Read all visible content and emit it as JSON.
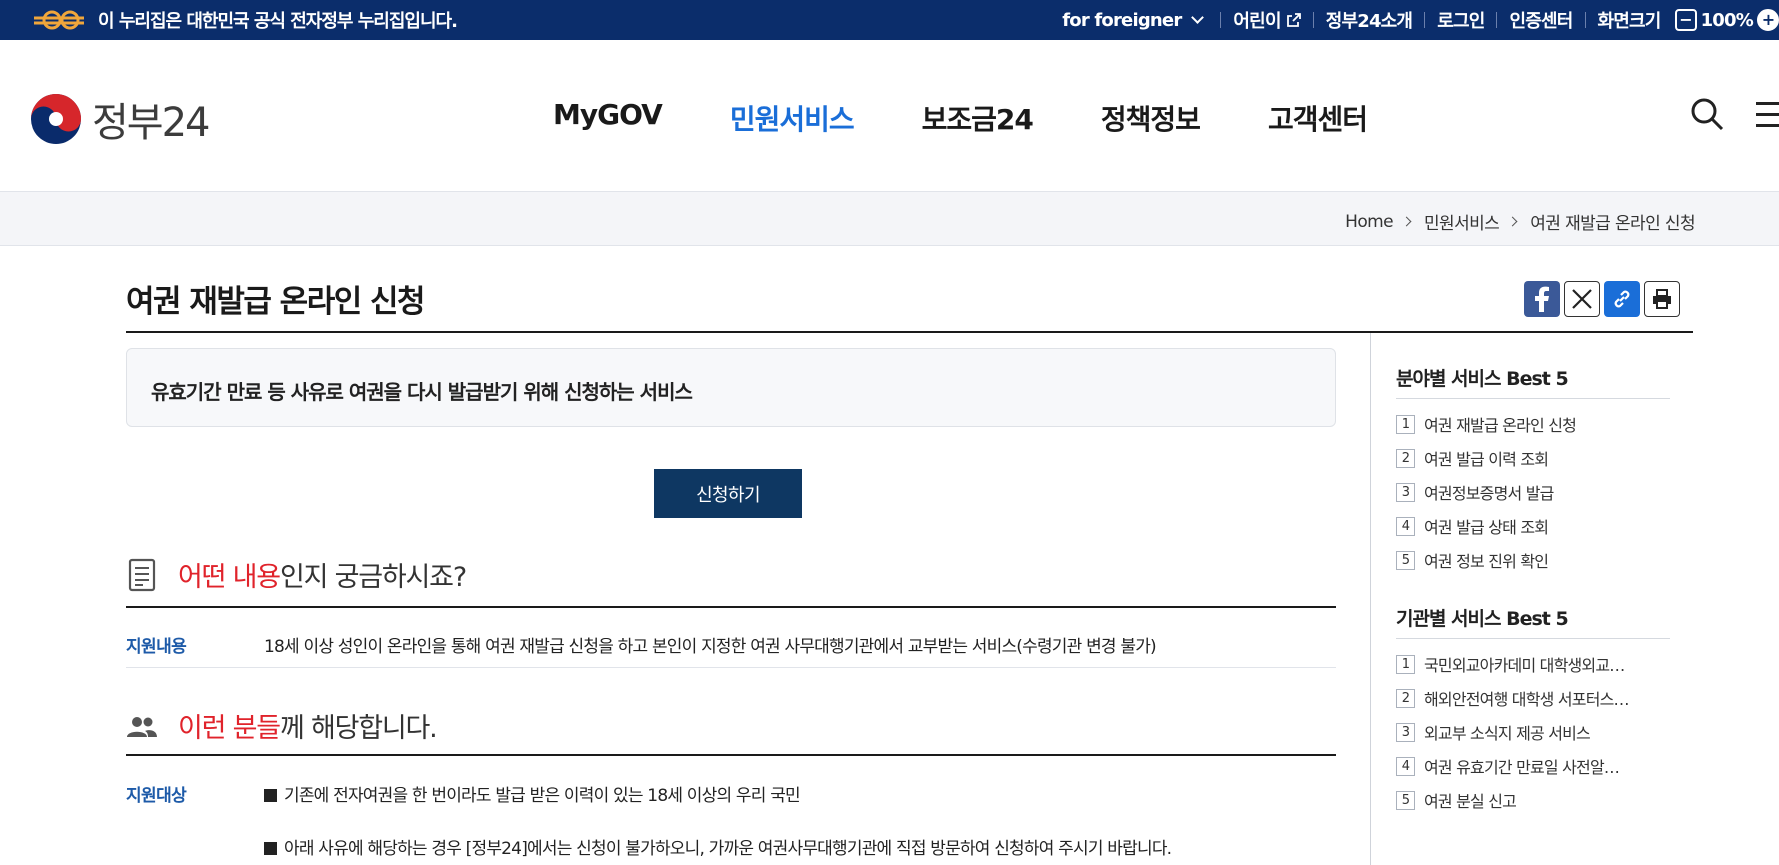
{
  "gov_banner": {
    "notice": "이 누리집은 대한민국 공식 전자정부 누리집입니다.",
    "links": {
      "foreigner": "for foreigner",
      "kids": "어린이",
      "about": "정부24소개",
      "login": "로그인",
      "cert": "인증센터",
      "screen_size": "화면크기",
      "zoom_minus": "−",
      "zoom_level": "100%",
      "zoom_plus": "+"
    }
  },
  "header": {
    "logo_text": "정부24",
    "nav": [
      "MyGOV",
      "민원서비스",
      "보조금24",
      "정책정보",
      "고객센터"
    ],
    "active_nav": "민원서비스"
  },
  "breadcrumb": [
    "Home",
    "민원서비스",
    "여권 재발급 온라인 신청"
  ],
  "page": {
    "title": "여권 재발급 온라인 신청",
    "summary": "유효기간 만료 등 사유로 여권을 다시 발급받기 위해 신청하는 서비스",
    "apply_label": "신청하기",
    "section1": {
      "highlight": "어떤 내용",
      "rest": "인지 궁금하시죠?",
      "label": "지원내용",
      "text": "18세 이상 성인이 온라인을 통해 여권 재발급 신청을 하고 본인이 지정한 여권 사무대행기관에서 교부받는 서비스(수령기관 변경 불가)"
    },
    "section2": {
      "highlight": "이런 분들",
      "rest": "께 해당합니다.",
      "label": "지원대상",
      "item1": "기존에 전자여권을 한 번이라도 발급 받은 이력이 있는 18세 이상의 우리 국민",
      "item2": "아래 사유에 해당하는 경우 [정부24]에서는 신청이 불가하오니, 가까운 여권사무대행기관에 직접 방문하여 신청하여 주시기 바랍니다."
    }
  },
  "sidebar": {
    "field_title": "분야별 서비스 Best 5",
    "field_items": [
      {
        "num": "1",
        "label": "여권 재발급 온라인 신청"
      },
      {
        "num": "2",
        "label": "여권 발급 이력 조회"
      },
      {
        "num": "3",
        "label": "여권정보증명서 발급"
      },
      {
        "num": "4",
        "label": "여권 발급 상태 조회"
      },
      {
        "num": "5",
        "label": "여권 정보 진위 확인"
      }
    ],
    "agency_title": "기관별 서비스 Best 5",
    "agency_items": [
      {
        "num": "1",
        "label": "국민외교아카데미 대학생외교…"
      },
      {
        "num": "2",
        "label": "해외안전여행 대학생 서포터스…"
      },
      {
        "num": "3",
        "label": "외교부 소식지 제공 서비스"
      },
      {
        "num": "4",
        "label": "여권 유효기간 만료일 사전알…"
      },
      {
        "num": "5",
        "label": "여권 분실 신고"
      }
    ]
  },
  "colors": {
    "gov_bar": "#0b2d6b",
    "active_nav": "#1a6ed8",
    "apply_button": "#0e3762",
    "highlight": "#e0232b",
    "label": "#1d5aa8"
  }
}
